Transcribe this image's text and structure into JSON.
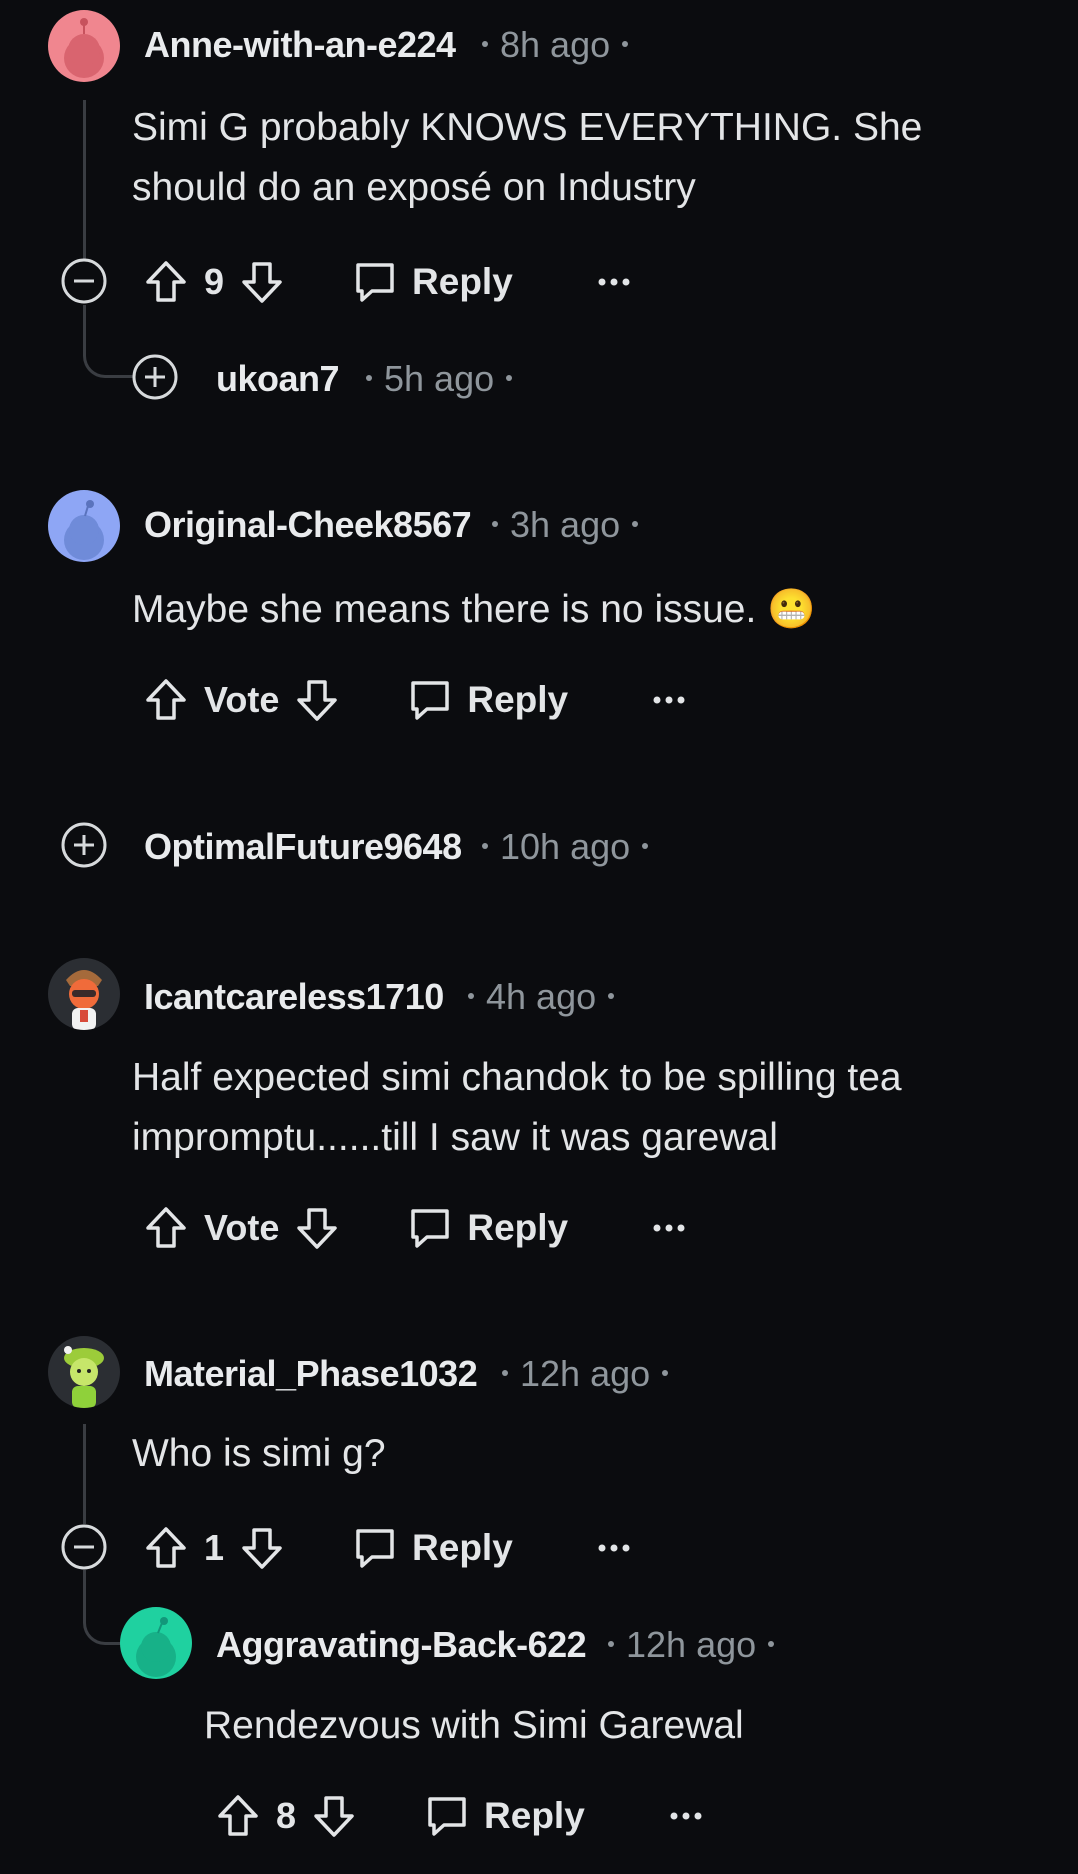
{
  "comments": [
    {
      "user": "Anne-with-an-e224",
      "time": "8h ago",
      "text": "Simi G probably KNOWS EVERYTHING. She should do an exposé on Industry",
      "votes": "9",
      "reply": "Reply"
    },
    {
      "user": "ukoan7",
      "time": "5h ago"
    },
    {
      "user": "Original-Cheek8567",
      "time": "3h ago",
      "text": "Maybe she means there is no issue. 😬",
      "votes": "Vote",
      "reply": "Reply"
    },
    {
      "user": "OptimalFuture9648",
      "time": "10h ago"
    },
    {
      "user": "Icantcareless1710",
      "time": "4h ago",
      "text": "Half expected simi chandok to be spilling tea impromptu......till I saw it was garewal",
      "votes": "Vote",
      "reply": "Reply"
    },
    {
      "user": "Material_Phase1032",
      "time": "12h ago",
      "text": "Who is simi g?",
      "votes": "1",
      "reply": "Reply"
    },
    {
      "user": "Aggravating-Back-622",
      "time": "12h ago",
      "text": "Rendezvous with Simi Garewal",
      "votes": "8",
      "reply": "Reply"
    }
  ],
  "colors": {
    "background": "#0b0c0f",
    "avatar_pink": "#f0868f",
    "avatar_blue": "#8ea6f5",
    "avatar_teal": "#1fd1a0"
  }
}
